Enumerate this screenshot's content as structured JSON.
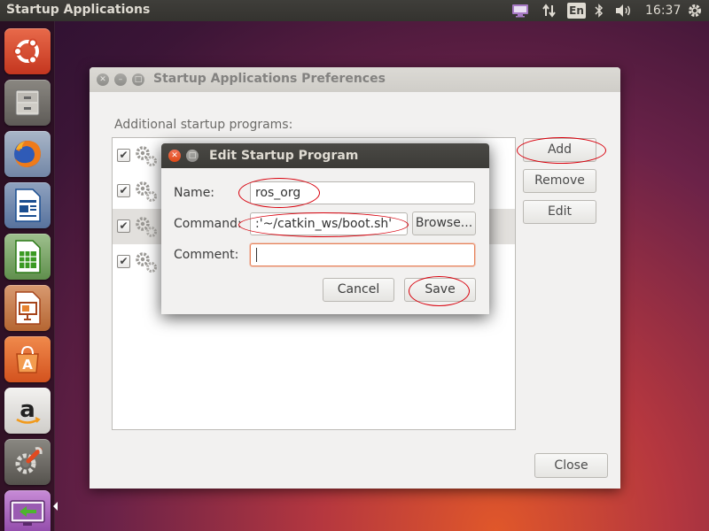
{
  "top_panel": {
    "app_title": "Startup Applications",
    "keyboard_layout": "En",
    "clock": "16:37",
    "indicators": [
      "screen-share-icon",
      "network-arrows-icon",
      "bluetooth-icon",
      "volume-icon",
      "power-gear-icon"
    ]
  },
  "launcher": {
    "items": [
      "ubuntu-dash-icon",
      "files-icon",
      "firefox-icon",
      "writer-icon",
      "calc-icon",
      "impress-icon",
      "software-center-icon",
      "amazon-icon",
      "system-settings-icon",
      "startup-apps-icon"
    ]
  },
  "main_window": {
    "title": "Startup Applications Preferences",
    "list_label": "Additional startup programs:",
    "rows": [
      {
        "checked": "✔"
      },
      {
        "checked": "✔"
      },
      {
        "checked": "✔"
      },
      {
        "checked": "✔"
      }
    ],
    "add_label": "Add",
    "remove_label": "Remove",
    "edit_label": "Edit",
    "close_label": "Close"
  },
  "edit_dialog": {
    "title": "Edit Startup Program",
    "name_label": "Name:",
    "name_value": "ros_org",
    "command_label": "Command:",
    "command_value": ":'~/catkin_ws/boot.sh'",
    "browse_label": "Browse...",
    "comment_label": "Comment:",
    "comment_value": "",
    "cancel_label": "Cancel",
    "save_label": "Save"
  },
  "colors": {
    "annotation": "#d8000c",
    "accent": "#e95420",
    "panel": "#3c3b37"
  }
}
